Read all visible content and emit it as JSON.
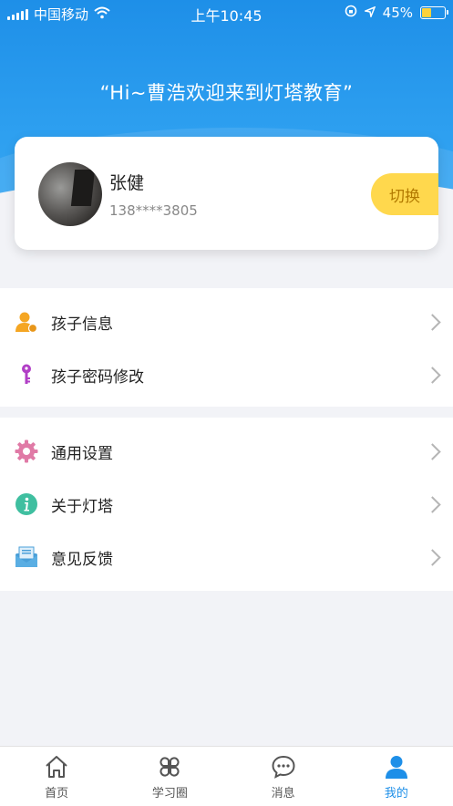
{
  "status_bar": {
    "carrier": "中国移动",
    "time": "上午10:45",
    "battery": "45%",
    "battery_level": 0.45
  },
  "header": {
    "welcome": "“Hi~曹浩欢迎来到灯塔教育”"
  },
  "profile": {
    "name": "张健",
    "phone": "138****3805",
    "switch_label": "切换"
  },
  "menu_groups": [
    {
      "items": [
        {
          "label": "孩子信息",
          "icon": "child-info-icon"
        },
        {
          "label": "孩子密码修改",
          "icon": "key-icon"
        }
      ]
    },
    {
      "items": [
        {
          "label": "通用设置",
          "icon": "gear-icon"
        },
        {
          "label": "关于灯塔",
          "icon": "info-icon"
        },
        {
          "label": "意见反馈",
          "icon": "feedback-mail-icon"
        }
      ]
    }
  ],
  "tabs": [
    {
      "label": "首页",
      "icon": "home-icon"
    },
    {
      "label": "学习圈",
      "icon": "clover-icon"
    },
    {
      "label": "消息",
      "icon": "chat-icon"
    },
    {
      "label": "我的",
      "icon": "user-icon",
      "active": true
    }
  ],
  "colors": {
    "primary": "#1e8fe8",
    "switch_bg": "#ffd84d",
    "switch_text": "#b27a00"
  }
}
